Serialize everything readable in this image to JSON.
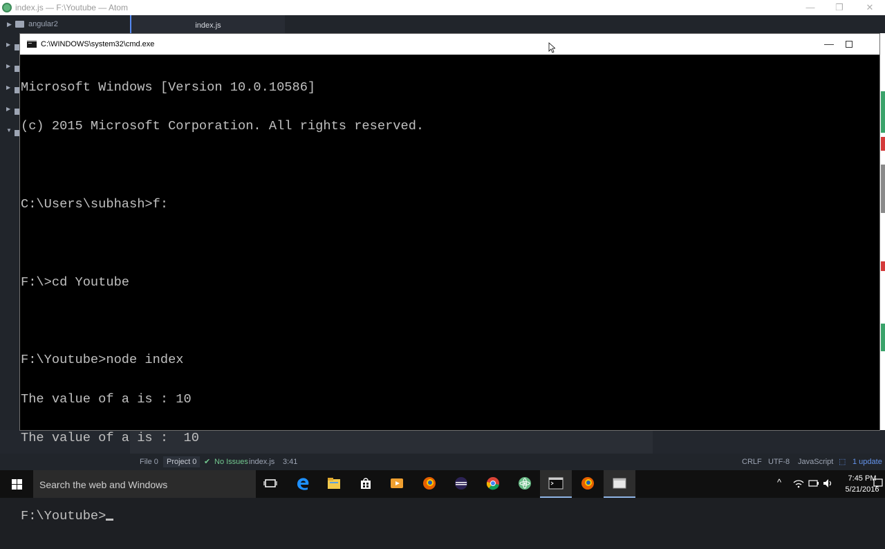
{
  "atom": {
    "window_title": "index.js — F:\\Youtube — Atom",
    "tree_root": "angular2",
    "tab_label": "index.js",
    "status": {
      "file": "File 0",
      "project": "Project 0",
      "issues": "No Issues",
      "filename": "index.js",
      "cursor_pos": "3:41",
      "line_ending": "CRLF",
      "encoding": "UTF-8",
      "grammar": "JavaScript",
      "update": "1 update"
    }
  },
  "cmd": {
    "title": "C:\\WINDOWS\\system32\\cmd.exe",
    "lines": [
      "Microsoft Windows [Version 10.0.10586]",
      "(c) 2015 Microsoft Corporation. All rights reserved.",
      "",
      "C:\\Users\\subhash>f:",
      "",
      "F:\\>cd Youtube",
      "",
      "F:\\Youtube>node index",
      "The value of a is : 10",
      "The value of a is :  10",
      "",
      "F:\\Youtube>"
    ]
  },
  "taskbar": {
    "search_placeholder": "Search the web and Windows",
    "time": "7:45 PM",
    "date": "5/21/2016"
  },
  "colors": {
    "console_bg": "#000000",
    "console_fg": "#c0c0c0",
    "atom_accent": "#568af2",
    "taskbar_bg": "#101010"
  }
}
